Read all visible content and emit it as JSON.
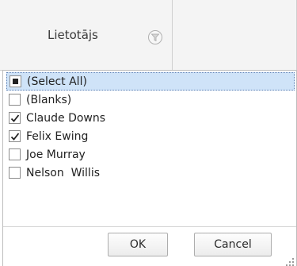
{
  "header": {
    "column_title": "Lietotājs",
    "filter_icon": "filter-icon"
  },
  "filter_list": {
    "items": [
      {
        "label": "(Select All)",
        "state": "indeterminate",
        "selected": true
      },
      {
        "label": "(Blanks)",
        "state": "unchecked",
        "selected": false
      },
      {
        "label": "Claude Downs",
        "state": "checked",
        "selected": false
      },
      {
        "label": "Felix Ewing",
        "state": "checked",
        "selected": false
      },
      {
        "label": "Joe Murray",
        "state": "unchecked",
        "selected": false
      },
      {
        "label": "Nelson  Willis",
        "state": "unchecked",
        "selected": false
      }
    ]
  },
  "footer": {
    "ok_label": "OK",
    "cancel_label": "Cancel",
    "resize_icon": "resize-grip-icon"
  },
  "colors": {
    "selection_bg": "#cfe3f8",
    "header_bg": "#f4f4f4"
  }
}
